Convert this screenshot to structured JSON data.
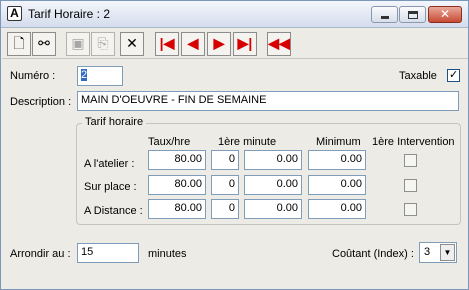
{
  "window": {
    "title": "Tarif Horaire : 2",
    "app_icon_letter": "A"
  },
  "titlebar_controls": {
    "minimize": "minimize-icon",
    "maximize": "maximize-icon",
    "close": "close-icon"
  },
  "toolbar": {
    "buttons": [
      {
        "icon": "new-document-icon",
        "glyph": "🗋",
        "enabled": true
      },
      {
        "icon": "binoculars-search-icon",
        "glyph": "🔭",
        "enabled": true
      },
      {
        "icon": "save-icon",
        "glyph": "🖫",
        "enabled": false
      },
      {
        "icon": "copy-icon",
        "glyph": "⎘",
        "enabled": false
      },
      {
        "icon": "delete-icon",
        "glyph": "✕",
        "enabled": true
      },
      {
        "icon": "first-record-icon",
        "glyph": "|◀",
        "enabled": true
      },
      {
        "icon": "previous-record-icon",
        "glyph": "◀",
        "enabled": true
      },
      {
        "icon": "next-record-icon",
        "glyph": "▶",
        "enabled": true
      },
      {
        "icon": "last-record-icon",
        "glyph": "▶|",
        "enabled": true
      },
      {
        "icon": "rewind-icon",
        "glyph": "◀◀",
        "enabled": true
      }
    ]
  },
  "form": {
    "numero_label": "Numéro :",
    "numero_value": "2",
    "taxable_label": "Taxable",
    "taxable_checked": true,
    "description_label": "Description :",
    "description_value": "MAIN D'OEUVRE - FIN DE SEMAINE",
    "group_title": "Tarif horaire",
    "columns": [
      "Taux/hre",
      "1ère minute",
      "Minimum",
      "1ère Intervention"
    ],
    "rows": [
      {
        "label": "A l'atelier :",
        "taux": "80.00",
        "minute_qty": "0",
        "minute_amount": "0.00",
        "minimum": "0.00",
        "intervention_checked": false
      },
      {
        "label": "Sur place :",
        "taux": "80.00",
        "minute_qty": "0",
        "minute_amount": "0.00",
        "minimum": "0.00",
        "intervention_checked": false
      },
      {
        "label": "A Distance :",
        "taux": "80.00",
        "minute_qty": "0",
        "minute_amount": "0.00",
        "minimum": "0.00",
        "intervention_checked": false
      }
    ],
    "arrondir_label": "Arrondir au :",
    "arrondir_value": "15",
    "arrondir_unit": "minutes",
    "coutant_label": "Coûtant (Index) :",
    "coutant_value": "3"
  }
}
